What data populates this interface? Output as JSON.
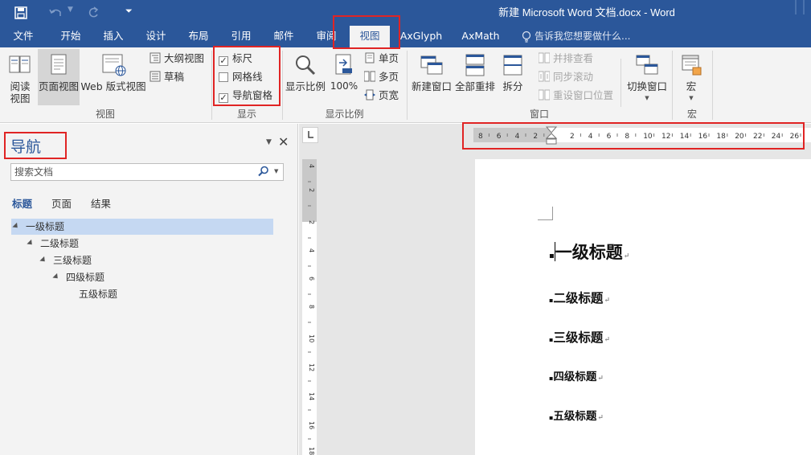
{
  "titlebar": {
    "title": "新建 Microsoft Word 文档.docx - Word",
    "qat": {
      "save_icon": "save-icon",
      "undo_icon": "undo-icon",
      "redo_icon": "redo-icon",
      "customize_icon": "customize-qat-icon"
    }
  },
  "tabs": [
    {
      "label": "文件"
    },
    {
      "label": "开始"
    },
    {
      "label": "插入"
    },
    {
      "label": "设计"
    },
    {
      "label": "布局"
    },
    {
      "label": "引用"
    },
    {
      "label": "邮件"
    },
    {
      "label": "审阅"
    },
    {
      "label": "视图",
      "active": true
    },
    {
      "label": "AxGlyph"
    },
    {
      "label": "AxMath"
    }
  ],
  "tell_me": "告诉我您想要做什么...",
  "ribbon": {
    "views": {
      "read_mode": "阅读\n视图",
      "print_layout": "页面视图",
      "web_layout": "Web 版式视图",
      "outline": "大纲视图",
      "draft": "草稿",
      "group_label": "视图"
    },
    "show": {
      "ruler": {
        "label": "标尺",
        "checked": true
      },
      "gridlines": {
        "label": "网格线",
        "checked": false
      },
      "nav_pane": {
        "label": "导航窗格",
        "checked": true
      },
      "group_label": "显示"
    },
    "zoom": {
      "zoom": "显示比例",
      "hundred": "100%",
      "one_page": "单页",
      "multi_page": "多页",
      "page_width": "页宽",
      "group_label": "显示比例"
    },
    "window": {
      "new_window": "新建窗口",
      "arrange_all": "全部重排",
      "split": "拆分",
      "side_by_side": "并排查看",
      "sync_scroll": "同步滚动",
      "reset_pos": "重设窗口位置",
      "switch": "切换窗口",
      "group_label": "窗口"
    },
    "macros": {
      "macros": "宏",
      "group_label": "宏"
    }
  },
  "nav": {
    "title": "导航",
    "search_placeholder": "搜索文档",
    "tabs": [
      "标题",
      "页面",
      "结果"
    ],
    "tree": [
      "一级标题",
      "二级标题",
      "三级标题",
      "四级标题",
      "五级标题"
    ]
  },
  "ruler_h": [
    "8",
    "6",
    "4",
    "2",
    "2",
    "4",
    "6",
    "8",
    "10",
    "12",
    "14",
    "16",
    "18",
    "20",
    "22",
    "24",
    "26",
    "28"
  ],
  "ruler_v": [
    "4",
    "2",
    "2",
    "4",
    "6",
    "8",
    "10",
    "12",
    "14",
    "16",
    "18"
  ],
  "document": {
    "headings": [
      "一级标题",
      "二级标题",
      "三级标题",
      "四级标题",
      "五级标题"
    ],
    "return_mark": "↵"
  },
  "colors": {
    "accent": "#2b579a",
    "highlight": "#e02424"
  }
}
